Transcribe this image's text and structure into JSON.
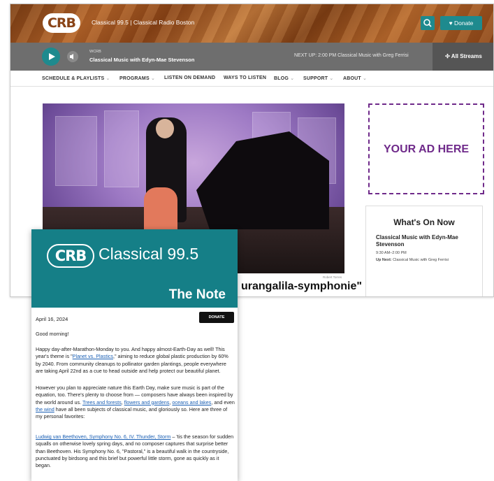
{
  "site": {
    "logo_text": "CRB",
    "station_name": "Classical 99.5 | Classical Radio Boston",
    "donate_label": "♥ Donate",
    "player": {
      "call_sign": "WCRB",
      "now_playing": "Classical Music with Edyn-Mae Stevenson",
      "next_up": "NEXT UP: 2:00 PM Classical Music with Greg Ferrisi",
      "all_streams": "✣ All Streams"
    },
    "nav": [
      {
        "label": "SCHEDULE & PLAYLISTS",
        "caret": true
      },
      {
        "label": "PROGRAMS",
        "caret": true
      },
      {
        "label": "LISTEN ON DEMAND",
        "caret": false
      },
      {
        "label": "WAYS TO LISTEN",
        "caret": false
      },
      {
        "label": "BLOG",
        "caret": true
      },
      {
        "label": "SUPPORT",
        "caret": true
      },
      {
        "label": "ABOUT",
        "caret": true
      }
    ],
    "hero_caption": "urangalila-symphonie\"",
    "photo_credit": "Robert Torres",
    "ad_text": "YOUR AD HERE",
    "whats_on": {
      "title": "What's On Now",
      "show": "Classical Music with Edyn-Mae Stevenson",
      "time": "9:30 AM–2:00 PM",
      "next_label": "Up Next:",
      "next_show": "Classical Music with Greg Ferrisi"
    }
  },
  "newsletter": {
    "logo_text": "CRB",
    "station": "Classical 99.5",
    "title": "The Note",
    "date": "April 16, 2024",
    "donate_label": "DONATE",
    "greeting": "Good morning!",
    "p1_a": "Happy day-after-Marathon-Monday to you. And happy almost-Earth-Day as well! This year's theme is \"",
    "p1_link": "Planet vs. Plastics",
    "p1_b": ",\" aiming to reduce global plastic production by 60% by 2040. From community cleanups to pollinator garden plantings, people everywhere are taking April 22nd as a cue to head outside and help protect our beautiful planet.",
    "p2_a": "However you plan to appreciate nature this Earth Day, make sure music is part of the equation, too. There's plenty to choose from — composers have always been inspired by the world around us. ",
    "p2_l1": "Trees and forests",
    "p2_sep1": ", ",
    "p2_l2": "flowers and gardens",
    "p2_sep2": ", ",
    "p2_l3": "oceans and lakes",
    "p2_sep3": ", and even ",
    "p2_l4": "the wind",
    "p2_b": " have all been subjects of classical music, and gloriously so. Here are three of my personal favorites:",
    "p3_link": "Ludwig van Beethoven, Symphony No. 6, IV. Thunder, Storm",
    "p3_b": " – 'tis the season for sudden squalls on otherwise lovely spring days, and no composer captures that surprise better than Beethoven. His Symphony No. 6, \"Pastoral,\" is a beautiful walk in the countryside, punctuated by birdsong and this brief but powerful little storm, gone as quickly as it began."
  }
}
